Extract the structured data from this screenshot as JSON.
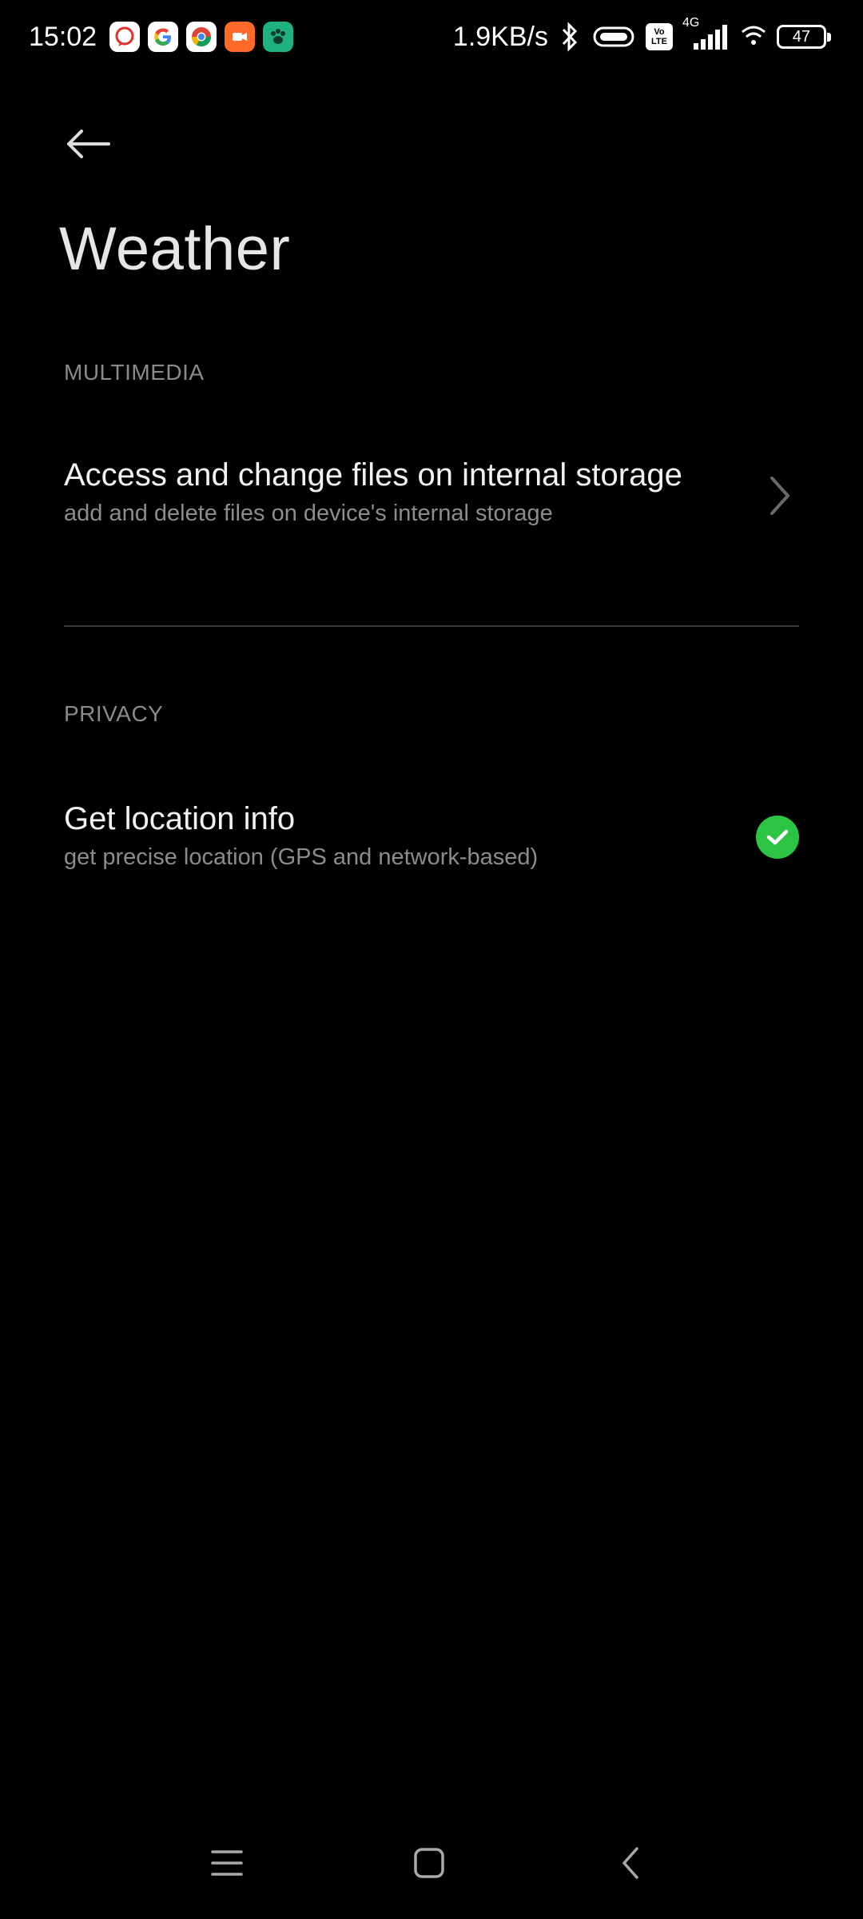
{
  "status_bar": {
    "time": "15:02",
    "net_speed": "1.9KB/s",
    "network_type": "4G",
    "volte_top": "Vo",
    "volte_bottom": "LTE",
    "battery": "47",
    "notification_icons": [
      "message-icon",
      "google-icon",
      "chrome-icon",
      "video-call-icon",
      "paw-app-icon"
    ],
    "colors": {
      "message": "#ffffff",
      "google": "#ffffff",
      "chrome": "#ffffff",
      "video": "#ff6a2a",
      "paw": "#1fb27e"
    }
  },
  "header": {
    "title": "Weather"
  },
  "sections": {
    "multimedia": {
      "label": "MULTIMEDIA",
      "item": {
        "title": "Access and change files on internal storage",
        "subtitle": "add and delete files on device's internal storage"
      }
    },
    "privacy": {
      "label": "PRIVACY",
      "item": {
        "title": "Get location info",
        "subtitle": "get precise location (GPS and network-based)",
        "enabled": true
      }
    }
  },
  "accent_color": "#2ec443",
  "nav_bar": {
    "icons": [
      "menu-icon",
      "home-icon",
      "back-icon"
    ]
  }
}
